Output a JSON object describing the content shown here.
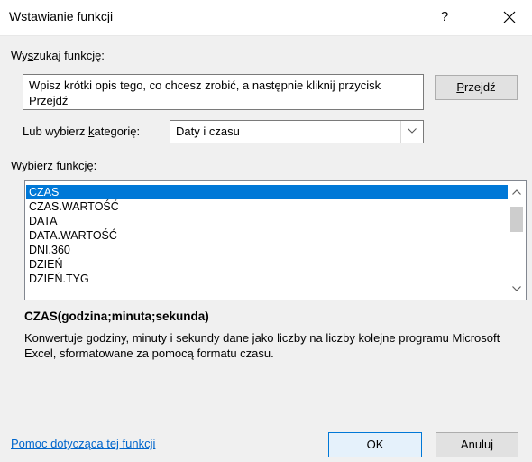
{
  "dialog": {
    "title": "Wstawianie funkcji",
    "help_label": "?",
    "close_icon": "close-icon"
  },
  "search": {
    "label_pre": "Wy",
    "label_key": "s",
    "label_post": "zukaj funkcję:",
    "value": "Wpisz krótki opis tego, co chcesz zrobić, a następnie kliknij przycisk Przejdź",
    "go_key": "P",
    "go_rest": "rzejdź"
  },
  "category": {
    "label_pre": "Lub wybierz ",
    "label_key": "k",
    "label_post": "ategorię:",
    "selected": "Daty i czasu"
  },
  "functions": {
    "label_key": "W",
    "label_post": "ybierz funkcję:",
    "items": [
      "CZAS",
      "CZAS.WARTOŚĆ",
      "DATA",
      "DATA.WARTOŚĆ",
      "DNI.360",
      "DZIEŃ",
      "DZIEŃ.TYG"
    ],
    "selected_index": 0
  },
  "details": {
    "signature": "CZAS(godzina;minuta;sekunda)",
    "description": "Konwertuje godziny, minuty i sekundy dane jako liczby na liczby kolejne programu Microsoft Excel, sformatowane za pomocą formatu czasu."
  },
  "footer": {
    "help_link": "Pomoc dotycząca tej funkcji",
    "ok_label": "OK",
    "cancel_label": "Anuluj"
  },
  "colors": {
    "selection": "#0078d7",
    "link": "#0066cc"
  }
}
